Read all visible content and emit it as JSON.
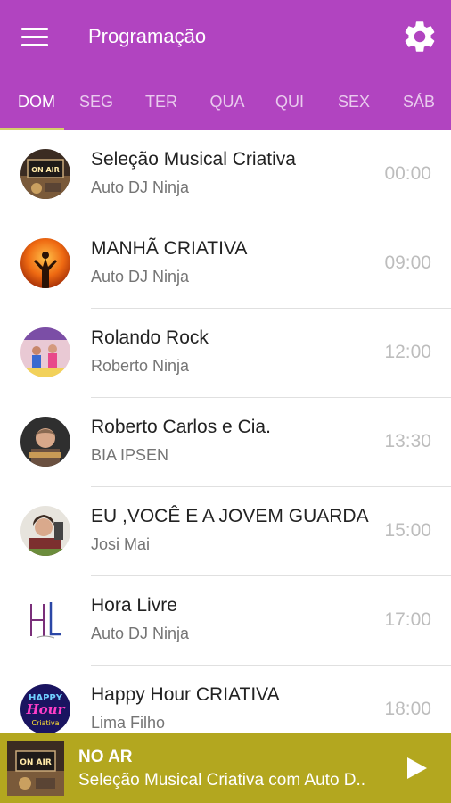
{
  "app": {
    "title": "Programação"
  },
  "tabs": [
    {
      "label": "DOM",
      "active": true
    },
    {
      "label": "SEG"
    },
    {
      "label": "TER"
    },
    {
      "label": "QUA"
    },
    {
      "label": "QUI"
    },
    {
      "label": "SEX"
    },
    {
      "label": "SÁB"
    }
  ],
  "schedule": [
    {
      "name": "Seleção Musical Criativa",
      "host": "Auto DJ Ninja",
      "time": "00:00"
    },
    {
      "name": "MANHÃ CRIATIVA",
      "host": "Auto DJ Ninja",
      "time": "09:00"
    },
    {
      "name": "Rolando Rock",
      "host": "Roberto Ninja",
      "time": "12:00"
    },
    {
      "name": "Roberto Carlos e Cia.",
      "host": "BIA IPSEN",
      "time": "13:30"
    },
    {
      "name": "EU ,VOCÊ E A JOVEM GUARDA",
      "host": "Josi Mai",
      "time": "15:00"
    },
    {
      "name": "Hora Livre",
      "host": "Auto DJ Ninja",
      "time": "17:00"
    },
    {
      "name": "Happy Hour CRIATIVA",
      "host": "Lima Filho",
      "time": "18:00"
    }
  ],
  "player": {
    "label": "NO AR",
    "now_playing": "Seleção Musical Criativa com Auto D..",
    "thumb_text": "ON AIR"
  },
  "logos": {
    "happy_hour_line1": "HAPPY",
    "happy_hour_line2": "Hour",
    "happy_hour_line3": "Criativa",
    "on_air": "ON AIR"
  },
  "colors": {
    "primary": "#b144c0",
    "accent": "#b3a71f",
    "indicator": "#d4cf6a"
  }
}
